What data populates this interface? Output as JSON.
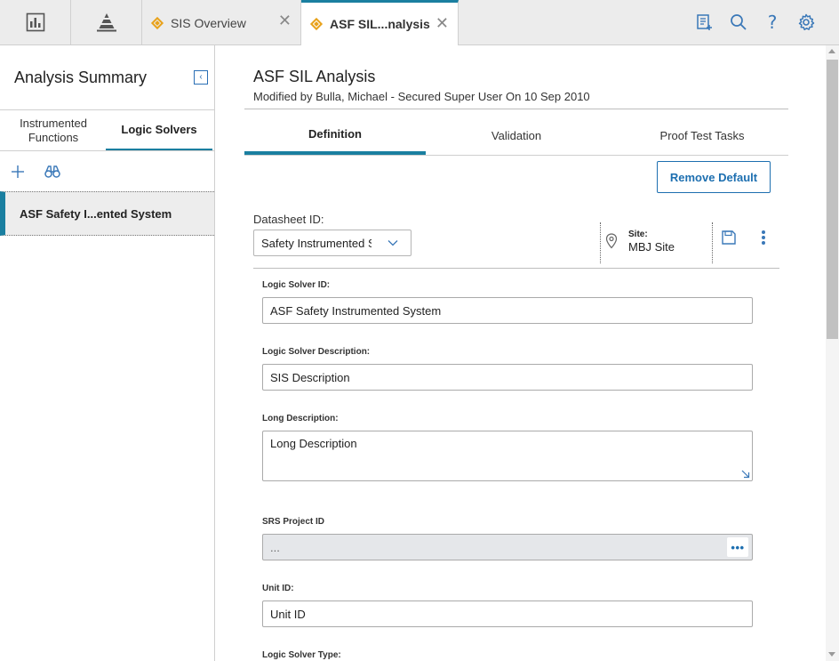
{
  "topbar": {
    "tabs": [
      {
        "label": "SIS Overview",
        "icon": "diamond-icon",
        "close": "✕"
      },
      {
        "label": "ASF SIL...nalysis",
        "icon": "diamond-icon",
        "close": "✕"
      }
    ],
    "left_icons": [
      "dashboard-icon",
      "pyramid-icon"
    ],
    "right_icons": [
      "new-record-icon",
      "search-icon",
      "help-icon",
      "gear-icon"
    ],
    "help_glyph": "?"
  },
  "left_panel": {
    "title": "Analysis Summary",
    "tabs": [
      {
        "label": "Instrumented Functions"
      },
      {
        "label": "Logic Solvers"
      }
    ],
    "toolbar": [
      "add-icon",
      "binoculars-icon"
    ],
    "items": [
      {
        "label": "ASF Safety I...ented System"
      }
    ]
  },
  "main": {
    "title": "ASF SIL Analysis",
    "subtitle": "Modified by Bulla, Michael - Secured Super User On 10 Sep 2010",
    "tabs": [
      {
        "label": "Definition"
      },
      {
        "label": "Validation"
      },
      {
        "label": "Proof Test Tasks"
      }
    ],
    "remove_default_label": "Remove Default",
    "datasheet": {
      "label": "Datasheet ID:",
      "value": "Safety Instrumented System"
    },
    "site": {
      "label": "Site:",
      "value": "MBJ Site"
    },
    "fields": [
      {
        "label": "Logic Solver ID:",
        "value": "ASF Safety Instrumented System"
      },
      {
        "label": "Logic Solver Description:",
        "value": "SIS Description"
      },
      {
        "label": "Long Description:",
        "value": "Long Description"
      },
      {
        "label": "SRS Project ID",
        "value": "...",
        "lookup": "•••"
      },
      {
        "label": "Unit ID:",
        "value": "Unit ID"
      },
      {
        "label": "Logic Solver Type:"
      }
    ]
  },
  "colors": {
    "accent": "#1a7fa0",
    "link_blue": "#1d6fb0",
    "tab_diamond": "#e8a21b"
  }
}
